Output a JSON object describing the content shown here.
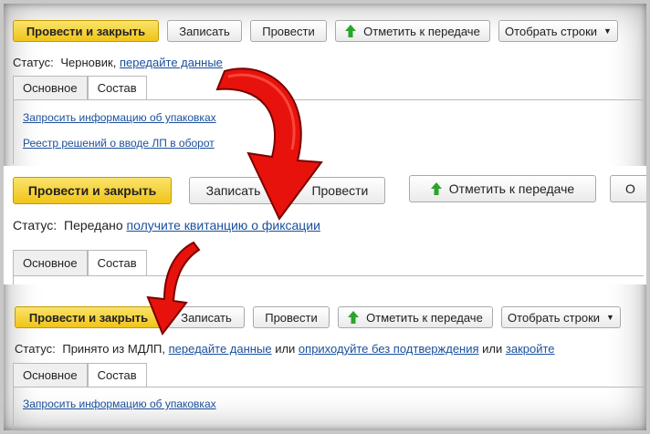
{
  "panel1": {
    "buttons": {
      "post_close": "Провести и закрыть",
      "save": "Записать",
      "post": "Провести",
      "mark_transfer": "Отметить к передаче",
      "select_rows": "Отобрать строки"
    },
    "status_label": "Статус:",
    "status_text": "Черновик,",
    "status_link": "передайте данные",
    "tabs": [
      "Основное",
      "Состав"
    ],
    "links": [
      "Запросить информацию об упаковках",
      "Реестр решений о вводе ЛП в оборот"
    ]
  },
  "panel2": {
    "buttons": {
      "post_close": "Провести и закрыть",
      "save": "Записать",
      "post": "Провести",
      "mark_transfer": "Отметить к передаче",
      "partial": "О"
    },
    "status_label": "Статус:",
    "status_text": "Передано",
    "status_link": "получите квитанцию о фиксации",
    "tabs": [
      "Основное",
      "Состав"
    ]
  },
  "panel3": {
    "buttons": {
      "post_close": "Провести и закрыть",
      "save": "Записать",
      "post": "Провести",
      "mark_transfer": "Отметить к передаче",
      "select_rows": "Отобрать строки"
    },
    "status_label": "Статус:",
    "status_text": "Принято из МДЛП,",
    "status_link1": "передайте данные",
    "status_or1": "или",
    "status_link2": "оприходуйте без подтверждения",
    "status_or2": "или",
    "status_link3": "закройте",
    "tabs": [
      "Основное",
      "Состав"
    ],
    "links": [
      "Запросить информацию об упаковках"
    ]
  },
  "colors": {
    "primary": "#f0c419",
    "link": "#1a4f9c",
    "arrow": "#e8120c",
    "green": "#2aa52a"
  }
}
